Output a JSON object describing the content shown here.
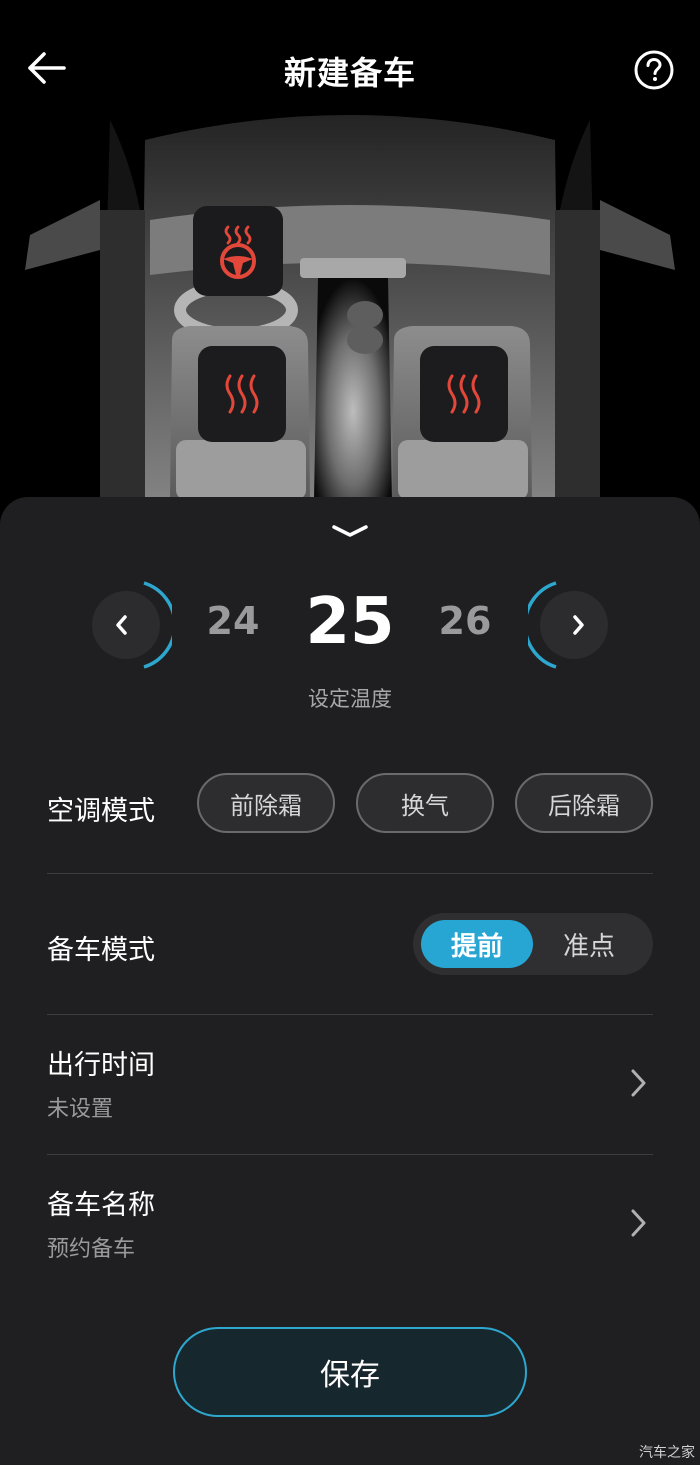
{
  "header": {
    "title": "新建备车",
    "back_icon": "arrow-left-icon",
    "help_icon": "question-circle-icon"
  },
  "car": {
    "steering_heat_icon": "steering-wheel-heat-icon",
    "seat_heat_left_icon": "seat-heat-icon",
    "seat_heat_right_icon": "seat-heat-icon",
    "heat_color": "#e2473a"
  },
  "temperature": {
    "prev": "24",
    "current": "25",
    "next": "26",
    "label": "设定温度"
  },
  "ac_mode": {
    "label": "空调模式",
    "options": [
      "前除霜",
      "换气",
      "后除霜"
    ]
  },
  "prep_mode": {
    "label": "备车模式",
    "options": [
      "提前",
      "准点"
    ],
    "selected": "提前"
  },
  "departure_time": {
    "title": "出行时间",
    "value": "未设置"
  },
  "prep_name": {
    "title": "备车名称",
    "value": "预约备车"
  },
  "save_label": "保存",
  "watermark": "汽车之家",
  "colors": {
    "accent": "#28a6d3",
    "panel": "#1f1f21",
    "background": "#000000"
  }
}
